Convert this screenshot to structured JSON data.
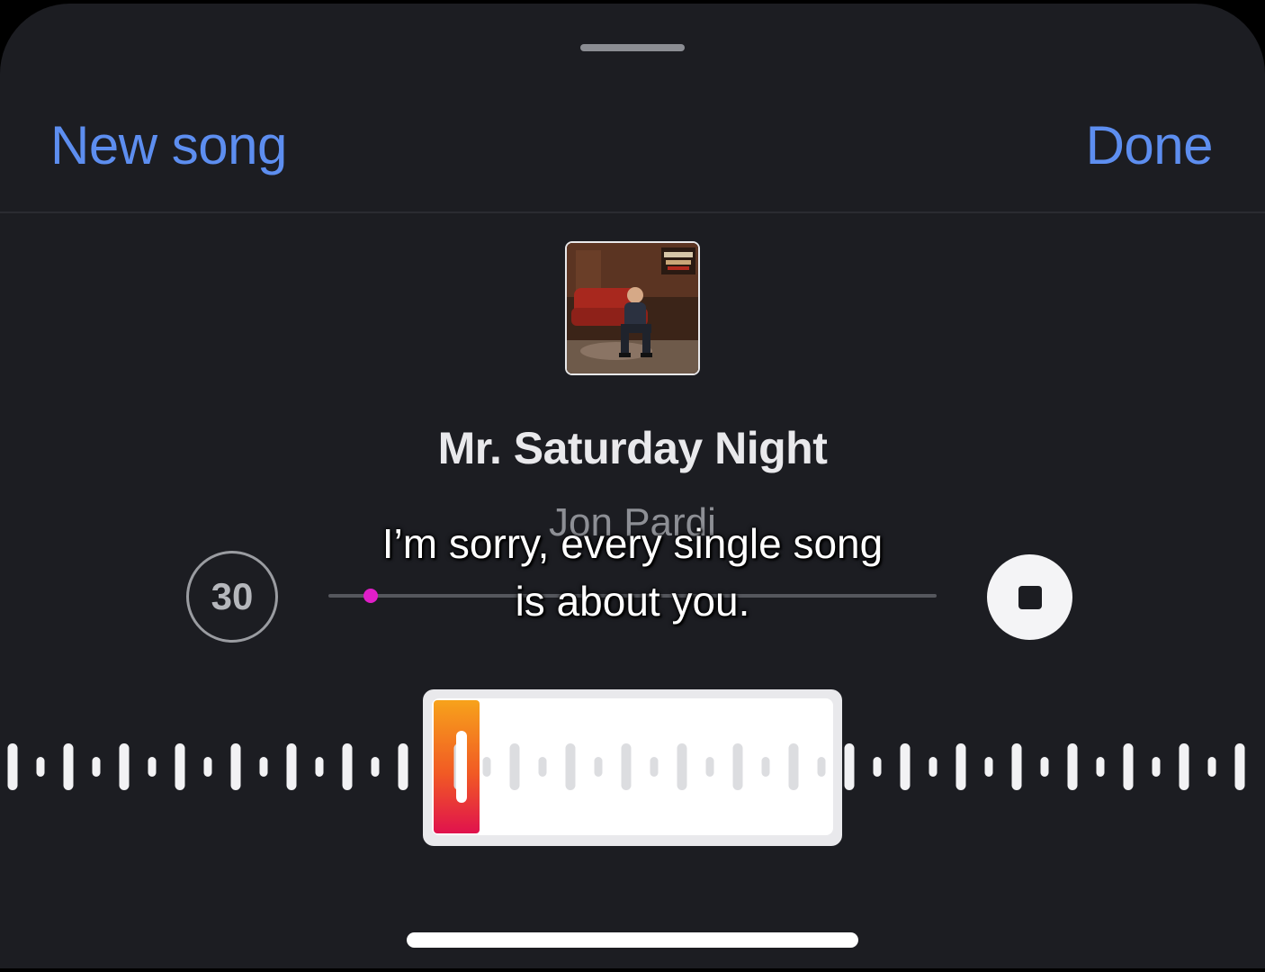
{
  "header": {
    "new_song_label": "New song",
    "done_label": "Done"
  },
  "track": {
    "title": "Mr. Saturday Night",
    "artist": "Jon Pardi"
  },
  "player": {
    "skip_label": "30",
    "progress": 0.07
  },
  "caption": {
    "line1": "I’m sorry, every single song",
    "line2": "is about you."
  },
  "colors": {
    "accent": "#5d8ef0",
    "progress_dot": "#e01ec8",
    "sheet_background": "#1c1d22"
  },
  "icons": {
    "skip": "skip-30-icon",
    "stop": "stop-icon"
  }
}
